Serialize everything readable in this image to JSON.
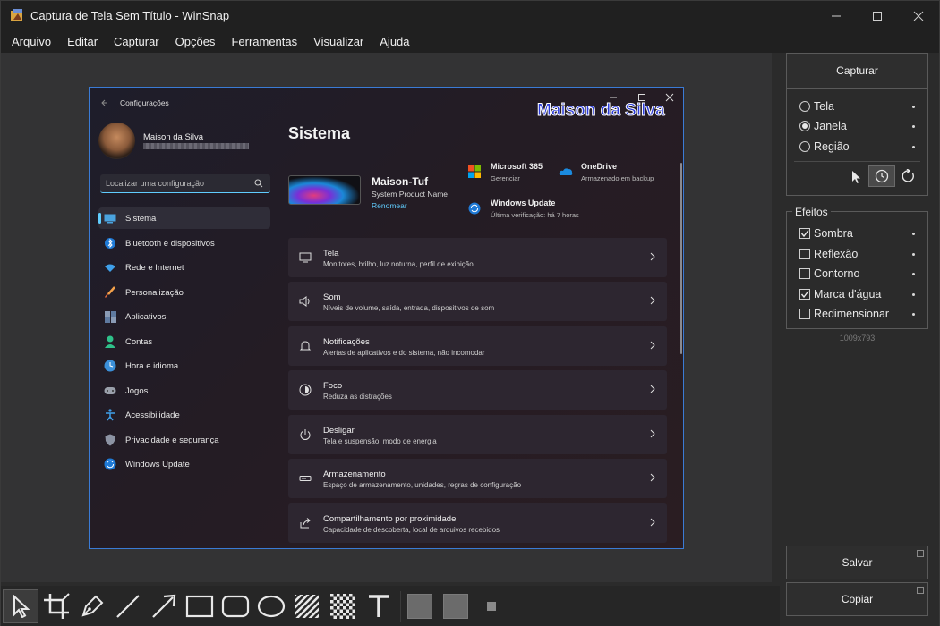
{
  "window": {
    "title": "Captura de Tela Sem Título - WinSnap"
  },
  "menu": [
    "Arquivo",
    "Editar",
    "Capturar",
    "Opções",
    "Ferramentas",
    "Visualizar",
    "Ajuda"
  ],
  "right_panel": {
    "capture_label": "Capturar",
    "capture_modes": [
      {
        "label": "Tela",
        "selected": false
      },
      {
        "label": "Janela",
        "selected": true
      },
      {
        "label": "Região",
        "selected": false
      }
    ],
    "effects_title": "Efeitos",
    "effects": [
      {
        "label": "Sombra",
        "checked": true
      },
      {
        "label": "Reflexão",
        "checked": false
      },
      {
        "label": "Contorno",
        "checked": false
      },
      {
        "label": "Marca d'água",
        "checked": true
      },
      {
        "label": "Redimensionar",
        "checked": false
      }
    ],
    "image_size": "1009x793",
    "save_label": "Salvar",
    "copy_label": "Copiar"
  },
  "tools": [
    "pointer-icon",
    "crop-icon",
    "pen-icon",
    "line-icon",
    "arrow-icon",
    "rectangle-icon",
    "rounded-rectangle-icon",
    "ellipse-icon",
    "hatch-icon",
    "pixelate-icon",
    "text-icon",
    "fill-color-swatch",
    "outline-color-swatch",
    "line-width-icon"
  ],
  "captured": {
    "window_title": "Configurações",
    "watermark": "Maison da Silva",
    "user_name": "Maison da Silva",
    "search_placeholder": "Localizar uma configuração",
    "nav": [
      "Sistema",
      "Bluetooth e dispositivos",
      "Rede e Internet",
      "Personalização",
      "Aplicativos",
      "Contas",
      "Hora e idioma",
      "Jogos",
      "Acessibilidade",
      "Privacidade e segurança",
      "Windows Update"
    ],
    "page_title": "Sistema",
    "device_name": "Maison-Tuf",
    "device_model": "System Product Name",
    "rename_link": "Renomear",
    "tiles": [
      {
        "title": "Microsoft 365",
        "sub": "Gerenciar"
      },
      {
        "title": "OneDrive",
        "sub": "Armazenado em backup"
      },
      {
        "title": "Windows Update",
        "sub": "Última verificação: há 7 horas"
      }
    ],
    "cards": [
      {
        "title": "Tela",
        "sub": "Monitores, brilho, luz noturna, perfil de exibição"
      },
      {
        "title": "Som",
        "sub": "Níveis de volume, saída, entrada, dispositivos de som"
      },
      {
        "title": "Notificações",
        "sub": "Alertas de aplicativos e do sistema, não incomodar"
      },
      {
        "title": "Foco",
        "sub": "Reduza as distrações"
      },
      {
        "title": "Desligar",
        "sub": "Tela e suspensão, modo de energia"
      },
      {
        "title": "Armazenamento",
        "sub": "Espaço de armazenamento, unidades, regras de configuração"
      },
      {
        "title": "Compartilhamento por proximidade",
        "sub": "Capacidade de descoberta, local de arquivos recebidos"
      }
    ]
  },
  "colors": {
    "accent": "#60cdff",
    "watermark": "#2a3ad8",
    "panel": "#2b2b2b",
    "canvas": "#333334"
  }
}
